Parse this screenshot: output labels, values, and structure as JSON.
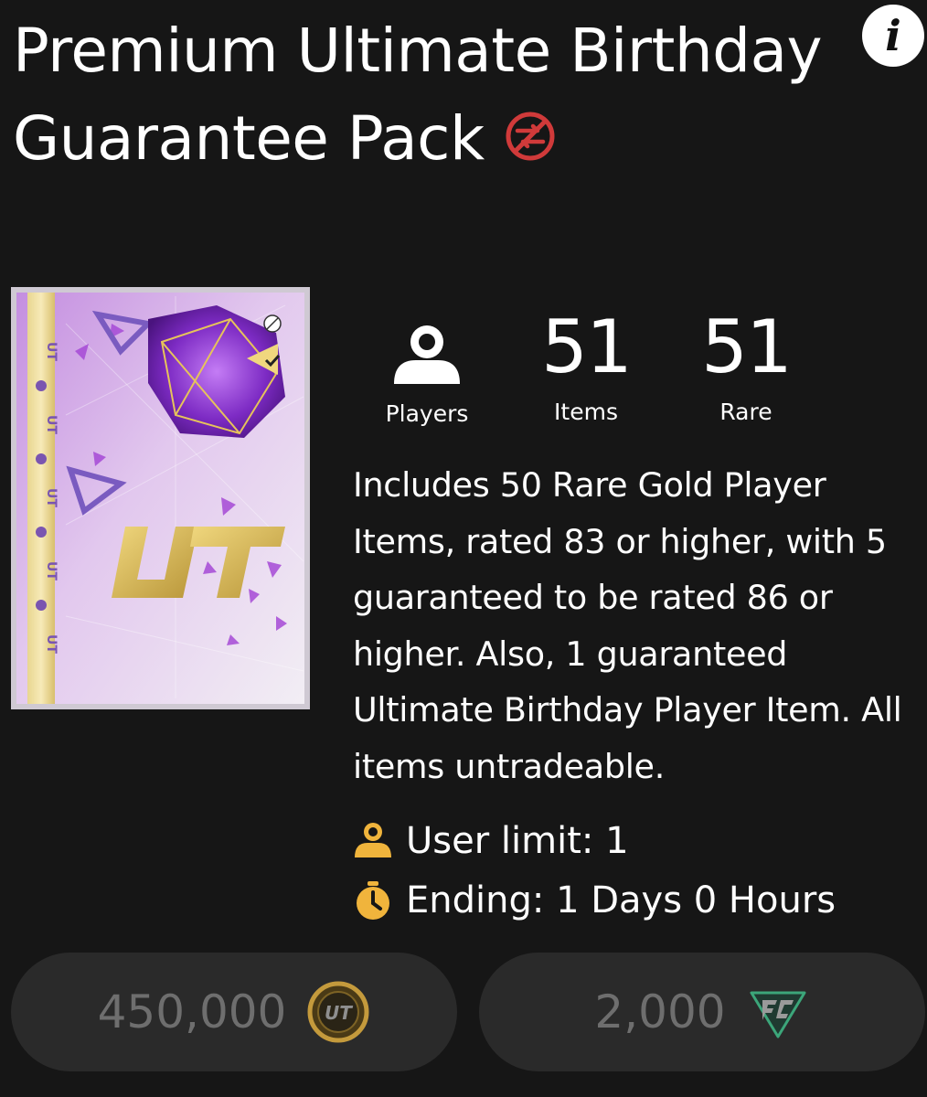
{
  "pack": {
    "title": "Premium Ultimate Birthday Guarantee Pack",
    "untradeable_icon": "no-trade-icon",
    "info_icon": "info-icon",
    "info_label": "i"
  },
  "stats": {
    "players_label": "Players",
    "players_icon": "person-icon",
    "items_value": "51",
    "items_label": "Items",
    "rare_value": "51",
    "rare_label": "Rare"
  },
  "description": "Includes 50 Rare Gold Player Items, rated 83 or higher, with 5 guaranteed to be rated 86 or higher. Also, 1 guaranteed Ultimate Birthday Player Item. All items untradeable.",
  "meta": {
    "user_limit": "User limit: 1",
    "ending": "Ending: 1 Days 0 Hours"
  },
  "prices": {
    "coins": "450,000",
    "coins_icon": "ut-coin-icon",
    "points": "2,000",
    "points_icon": "fc-points-icon"
  },
  "art_labels": {
    "ut": "UT"
  },
  "colors": {
    "background": "#161616",
    "accent_gold": "#f0b43c",
    "untradeable_red": "#d03a3a",
    "pack_purple": "#b86ad8"
  }
}
